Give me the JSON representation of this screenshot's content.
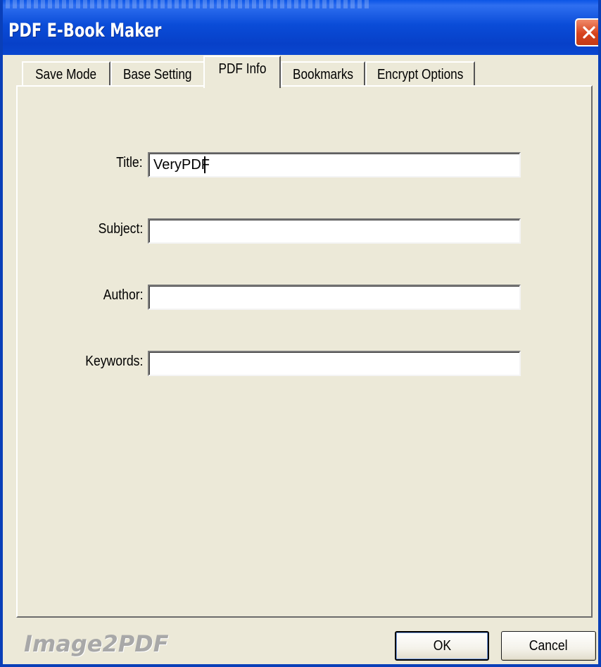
{
  "window": {
    "title": "PDF E-Book Maker",
    "close_icon": "close-icon",
    "close_color": "#d7431d",
    "titlebar_color": "#0a4cd8"
  },
  "tabs": [
    {
      "label": "Save Mode",
      "active": false
    },
    {
      "label": "Base Setting",
      "active": false
    },
    {
      "label": "PDF Info",
      "active": true
    },
    {
      "label": "Bookmarks",
      "active": false
    },
    {
      "label": "Encrypt Options",
      "active": false
    }
  ],
  "fields": {
    "title": {
      "label": "Title:",
      "value": "VeryPDF"
    },
    "subject": {
      "label": "Subject:",
      "value": ""
    },
    "author": {
      "label": "Author:",
      "value": ""
    },
    "keywords": {
      "label": "Keywords:",
      "value": ""
    }
  },
  "footer": {
    "brand": "Image2PDF",
    "ok_label": "OK",
    "cancel_label": "Cancel"
  }
}
